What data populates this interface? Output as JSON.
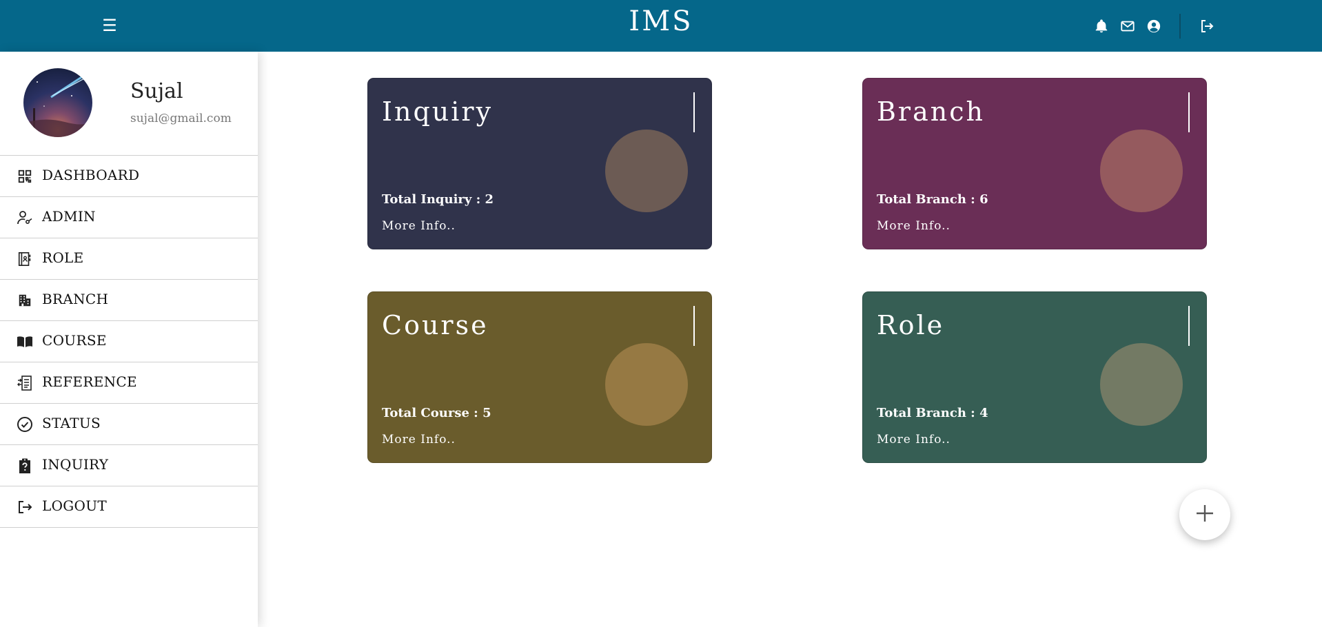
{
  "header": {
    "title": "IMS",
    "menu_icon": "hamburger-icon",
    "icons": [
      "bell-icon",
      "mail-icon",
      "account-circle-icon",
      "logout-icon"
    ]
  },
  "profile": {
    "name": "Sujal",
    "email": "sujal@gmail.com"
  },
  "sidebar": {
    "items": [
      {
        "label": "DASHBOARD",
        "icon": "dashboard-icon"
      },
      {
        "label": "ADMIN",
        "icon": "admin-icon"
      },
      {
        "label": "ROLE",
        "icon": "role-icon"
      },
      {
        "label": "BRANCH",
        "icon": "building-icon"
      },
      {
        "label": "COURSE",
        "icon": "book-icon"
      },
      {
        "label": "REFERENCE",
        "icon": "reference-icon"
      },
      {
        "label": "STATUS",
        "icon": "check-circle-icon"
      },
      {
        "label": "INQUIRY",
        "icon": "clipboard-question-icon"
      },
      {
        "label": "LOGOUT",
        "icon": "logout-icon"
      }
    ]
  },
  "cards": [
    {
      "title": "Inquiry",
      "total": "Total Inquiry : 2",
      "more": "More Info..",
      "bg": "#30334b",
      "circle": "#6c5b54"
    },
    {
      "title": "Branch",
      "total": "Total Branch : 6",
      "more": "More Info..",
      "bg": "#6a2e56",
      "circle": "#955a5e"
    },
    {
      "title": "Course",
      "total": "Total Course : 5",
      "more": "More Info..",
      "bg": "#6a5c2c",
      "circle": "#967943"
    },
    {
      "title": "Role",
      "total": "Total Branch : 4",
      "more": "More Info..",
      "bg": "#365e54",
      "circle": "#737a64"
    }
  ],
  "fab": {
    "icon": "plus-icon"
  },
  "colors": {
    "topbar": "#05678a",
    "sidebar_border": "#cfcfcf"
  }
}
